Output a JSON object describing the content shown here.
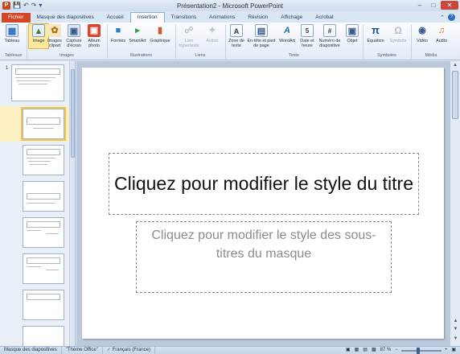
{
  "window": {
    "title": "Présentation2 - Microsoft PowerPoint",
    "qat_icons": [
      "powerpoint-logo",
      "save-icon",
      "undo-icon",
      "redo-icon",
      "customize-qat-icon"
    ],
    "controls": [
      "minimize",
      "maximize",
      "close"
    ]
  },
  "tabs": [
    {
      "label": "Fichier",
      "kind": "file"
    },
    {
      "label": "Masque des diapositives"
    },
    {
      "label": "Accueil"
    },
    {
      "label": "Insertion",
      "active": true
    },
    {
      "label": "Transitions"
    },
    {
      "label": "Animations"
    },
    {
      "label": "Révision"
    },
    {
      "label": "Affichage"
    },
    {
      "label": "Acrobat"
    }
  ],
  "ribbon": {
    "groups": {
      "tableaux": "Tableaux",
      "images": "Images",
      "illustrations": "Illustrations",
      "liens": "Liens",
      "texte": "Texte",
      "symboles": "Symboles",
      "media": "Média"
    },
    "buttons": {
      "tableau": "Tableau",
      "image": "Image",
      "images_clipart": "Images clipart",
      "capture": "Capture d'écran",
      "album": "Album photo",
      "formes": "Formes",
      "smartart": "SmartArt",
      "graphique": "Graphique",
      "lien": "Lien hypertexte",
      "action": "Action",
      "zone_texte": "Zone de texte",
      "entete": "En-tête et pied de page",
      "wordart": "WordArt",
      "date_heure": "Date et heure",
      "numero": "Numéro de diapositive",
      "objet": "Objet",
      "equation": "Équation",
      "symbole": "Symbole",
      "video": "Vidéo",
      "audio": "Audio"
    },
    "selected_button": "image"
  },
  "thumbnails": {
    "first_number": "1",
    "title_text": "Cliquez pour modifier le style du titre",
    "count": 9,
    "selected_index": 1
  },
  "slide": {
    "title_placeholder": "Cliquez pour modifier le style du titre",
    "subtitle_placeholder": "Cliquez pour modifier le style des sous-titres du masque"
  },
  "statusbar": {
    "view": "Masque des diapositives",
    "theme": "\"Thème Office\"",
    "language": "Français (France)",
    "zoom": "87 %",
    "zoom_percent": 87
  }
}
